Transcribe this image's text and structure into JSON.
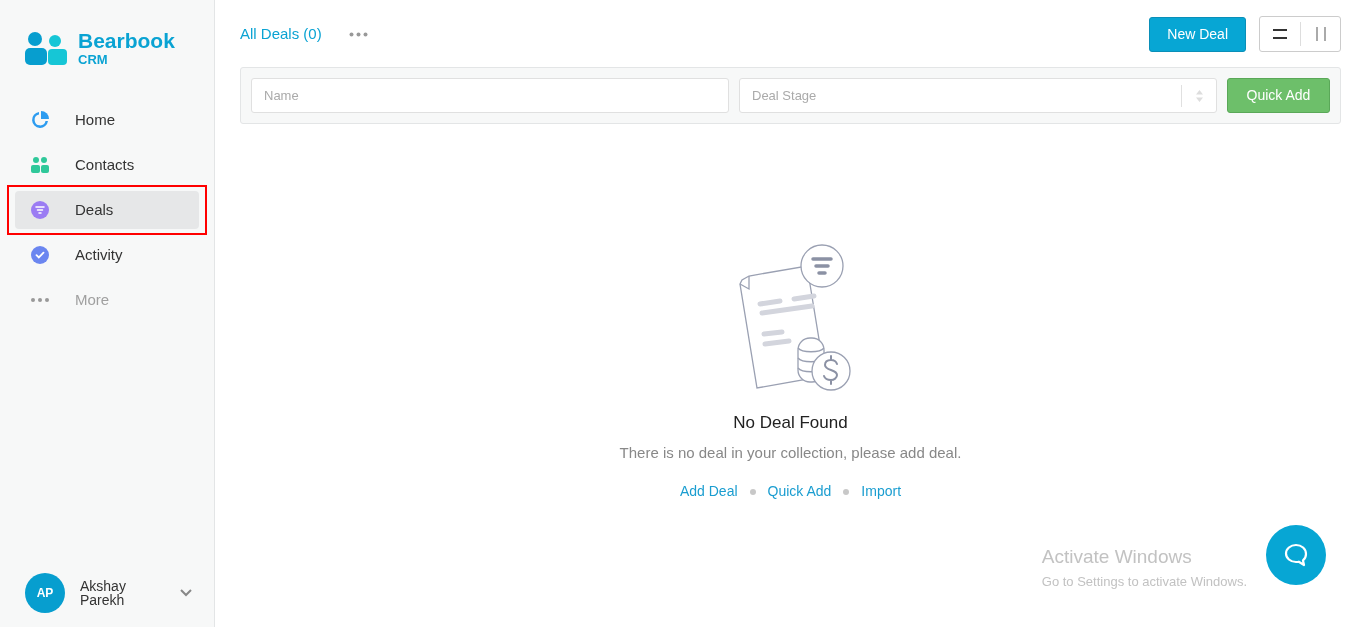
{
  "brand": {
    "name": "Bearbook",
    "sub": "CRM"
  },
  "nav": [
    {
      "label": "Home",
      "selected": false,
      "disabled": false
    },
    {
      "label": "Contacts",
      "selected": false,
      "disabled": false
    },
    {
      "label": "Deals",
      "selected": true,
      "disabled": false,
      "highlighted": true
    },
    {
      "label": "Activity",
      "selected": false,
      "disabled": false
    },
    {
      "label": "More",
      "selected": false,
      "disabled": true
    }
  ],
  "user": {
    "initials": "AP",
    "name": "Akshay Parekh"
  },
  "header": {
    "title": "All Deals (0)",
    "new_button": "New Deal",
    "views": [
      {
        "selected": true
      },
      {
        "selected": false
      }
    ]
  },
  "filters": {
    "name_placeholder": "Name",
    "stage_placeholder": "Deal Stage",
    "button": "Quick Add"
  },
  "empty": {
    "title": "No Deal Found",
    "message": "There is no deal in your collection, please add deal.",
    "links": [
      "Add Deal",
      "Quick Add",
      "Import"
    ]
  },
  "os_notice": {
    "title": "Activate Windows",
    "text": "Go to Settings to activate Windows."
  }
}
